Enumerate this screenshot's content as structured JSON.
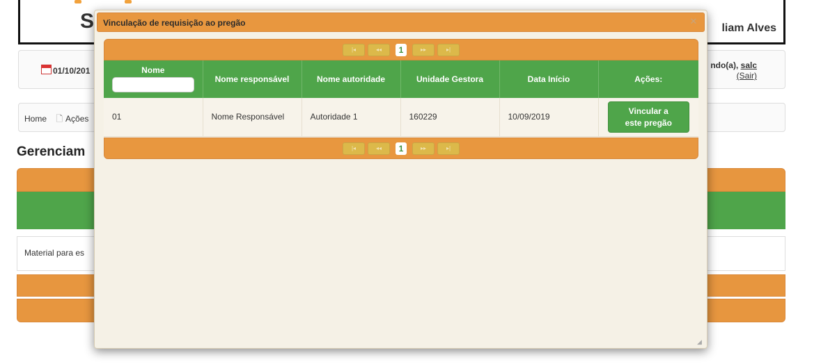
{
  "background": {
    "logo_letter": "S",
    "user_name": "liam Alves",
    "date": "01/10/201",
    "welcome_prefix": "ndo(a), ",
    "welcome_user": "salc",
    "logout": "(Sair)",
    "breadcrumb_home": "Home",
    "breadcrumb_actions": "Ações",
    "page_title": "Gerenciam",
    "row_text": "Material para es"
  },
  "modal": {
    "title": "Vinculação de requisição ao pregão",
    "close_icon": "close-icon",
    "pager": {
      "current_page": "1",
      "first": "|◂",
      "prev": "◂◂",
      "next": "▸▸",
      "last": "▸|"
    },
    "columns": [
      "Nome",
      "Nome responsável",
      "Nome autoridade",
      "Unidade Gestora",
      "Data Início",
      "Ações:"
    ],
    "filter": {
      "value": "",
      "placeholder": ""
    },
    "rows": [
      {
        "nome": "01",
        "responsavel": "Nome Responsável",
        "autoridade": "Autoridade 1",
        "unidade": "160229",
        "data_inicio": "10/09/2019",
        "action_label_line1": "Vincular a",
        "action_label_line2": "este pregão"
      }
    ]
  },
  "colors": {
    "orange": "#e8973f",
    "green": "#4fa54a",
    "modal_bg": "#f5f1e6"
  }
}
